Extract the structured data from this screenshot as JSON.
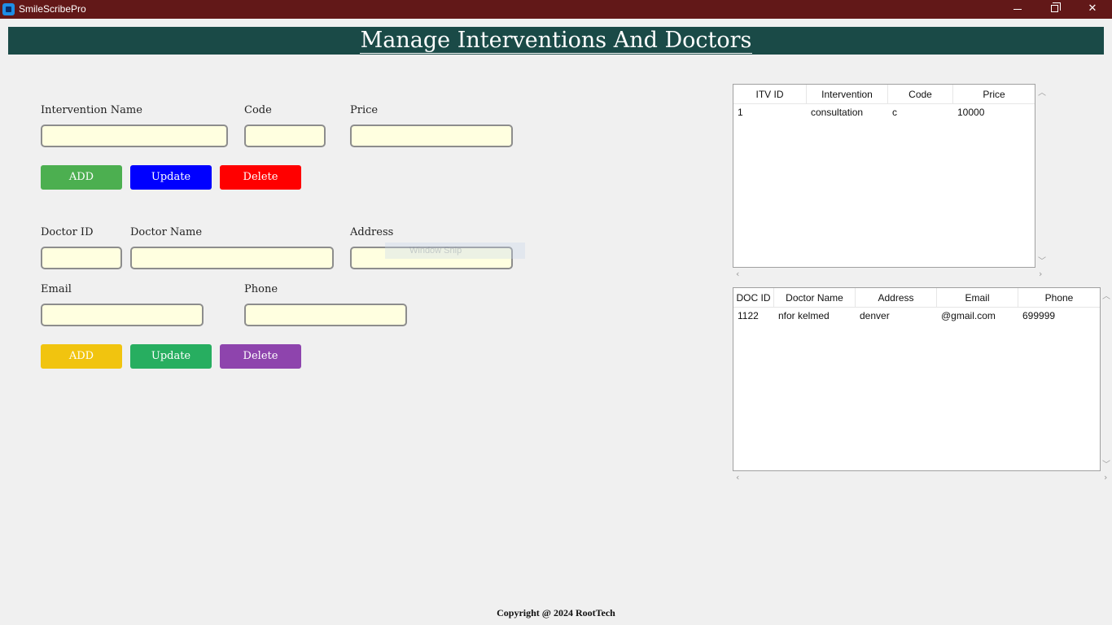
{
  "window": {
    "title": "SmileScribePro",
    "minimize_glyph": "",
    "maximize_glyph": "",
    "close_glyph": "✕"
  },
  "header": {
    "title": "Manage Interventions And Doctors"
  },
  "interventions_form": {
    "name_label": "Intervention Name",
    "code_label": "Code",
    "price_label": "Price",
    "name_value": "",
    "code_value": "",
    "price_value": "",
    "add_label": "ADD",
    "update_label": "Update",
    "delete_label": "Delete"
  },
  "doctors_form": {
    "id_label": "Doctor ID",
    "name_label": "Doctor Name",
    "address_label": "Address",
    "email_label": "Email",
    "phone_label": "Phone",
    "id_value": "",
    "name_value": "",
    "address_value": "",
    "email_value": "",
    "phone_value": "",
    "add_label": "ADD",
    "update_label": "Update",
    "delete_label": "Delete"
  },
  "interventions_table": {
    "columns": [
      "ITV ID",
      "Intervention",
      "Code",
      "Price"
    ],
    "rows": [
      [
        "1",
        "consultation",
        "c",
        "10000"
      ]
    ]
  },
  "doctors_table": {
    "columns": [
      "DOC ID",
      "Doctor Name",
      "Address",
      "Email",
      "Phone"
    ],
    "rows": [
      [
        "1122",
        "nfor kelmed",
        "denver",
        "@gmail.com",
        "699999"
      ]
    ]
  },
  "overlay": {
    "snip_text": "Window Snip"
  },
  "footer": {
    "text": "Copyright @ 2024 RootTech"
  },
  "colors": {
    "titlebar": "#621818",
    "header": "#1a4a47",
    "field_bg": "#ffffe0",
    "itv_add": "#4caf50",
    "itv_update": "#0000ff",
    "itv_delete": "#ff0000",
    "doc_add": "#f1c40f",
    "doc_update": "#27ae60",
    "doc_delete": "#8e44ad"
  }
}
